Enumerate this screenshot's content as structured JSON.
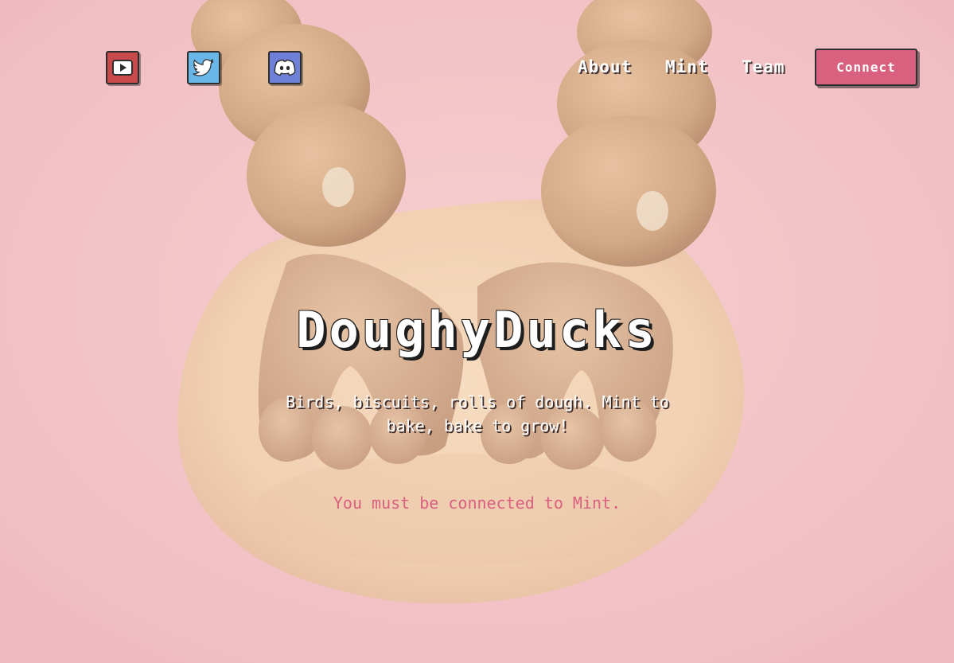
{
  "social": {
    "youtube_icon": "youtube-icon",
    "twitter_icon": "twitter-icon",
    "discord_icon": "discord-icon"
  },
  "nav": {
    "about": "About",
    "mint": "Mint",
    "team": "Team",
    "connect": "Connect"
  },
  "hero": {
    "title": "DoughyDucks",
    "tagline": "Birds, biscuits, rolls of dough. Mint to bake, bake to grow!",
    "status": "You must be connected to Mint."
  },
  "colors": {
    "background": "#f2c1c6",
    "accent": "#d9607f",
    "youtube": "#c84a4a",
    "twitter": "#69b7e8",
    "discord": "#6f80d8"
  }
}
